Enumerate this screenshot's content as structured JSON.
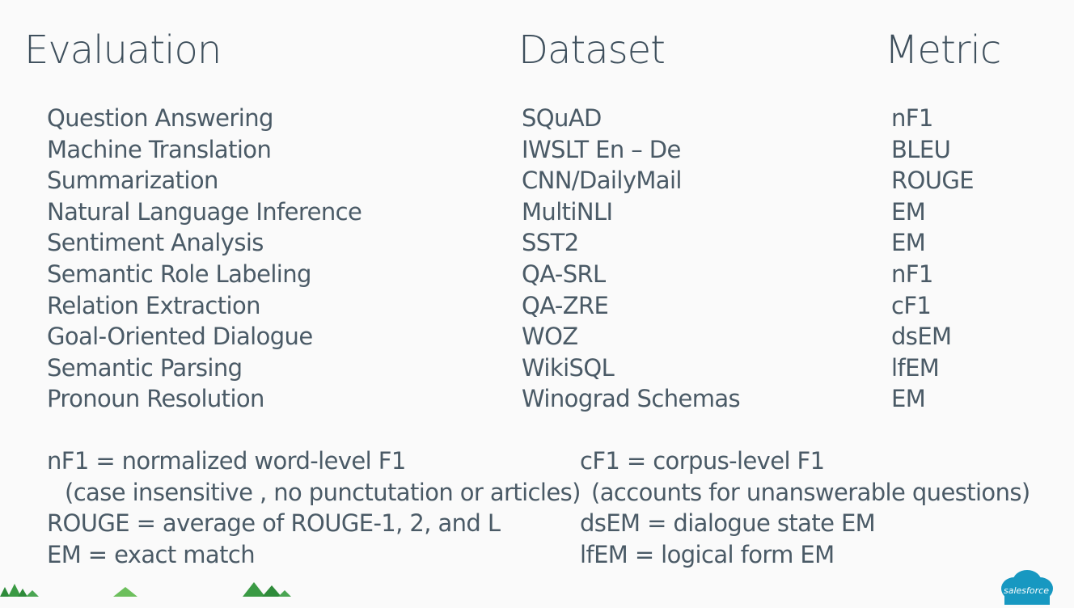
{
  "headers": {
    "evaluation": "Evaluation",
    "dataset": "Dataset",
    "metric": "Metric"
  },
  "rows": [
    {
      "task": "Question Answering",
      "dataset": "SQuAD",
      "metric": "nF1"
    },
    {
      "task": "Machine Translation",
      "dataset": "IWSLT En – De",
      "metric": "BLEU"
    },
    {
      "task": "Summarization",
      "dataset": "CNN/DailyMail",
      "metric": "ROUGE"
    },
    {
      "task": "Natural Language Inference",
      "dataset": "MultiNLI",
      "metric": "EM"
    },
    {
      "task": "Sentiment Analysis",
      "dataset": "SST2",
      "metric": "EM"
    },
    {
      "task": "Semantic Role Labeling",
      "dataset": "QA-SRL",
      "metric": "nF1"
    },
    {
      "task": "Relation Extraction",
      "dataset": "QA-ZRE",
      "metric": "cF1"
    },
    {
      "task": "Goal-Oriented Dialogue",
      "dataset": "WOZ",
      "metric": "dsEM"
    },
    {
      "task": "Semantic Parsing",
      "dataset": "WikiSQL",
      "metric": "lfEM"
    },
    {
      "task": "Pronoun Resolution",
      "dataset": "Winograd Schemas",
      "metric": "EM"
    }
  ],
  "legend_left": {
    "nf1": "nF1 = normalized word-level F1",
    "nf1_note": "(case insensitive , no punctutation or articles)",
    "rouge": "ROUGE = average of ROUGE-1, 2, and L",
    "em": "EM = exact match"
  },
  "legend_right": {
    "cf1": "cF1 = corpus-level F1",
    "cf1_note": "(accounts for unanswerable questions)",
    "dsem": "dsEM = dialogue state EM",
    "lfem": "lfEM = logical form EM"
  },
  "logo": {
    "text": "salesforce",
    "color": "#1798c1"
  },
  "colors": {
    "background": "#fafafa",
    "text": "#4a5a66",
    "trees": "#2e8b3a"
  }
}
